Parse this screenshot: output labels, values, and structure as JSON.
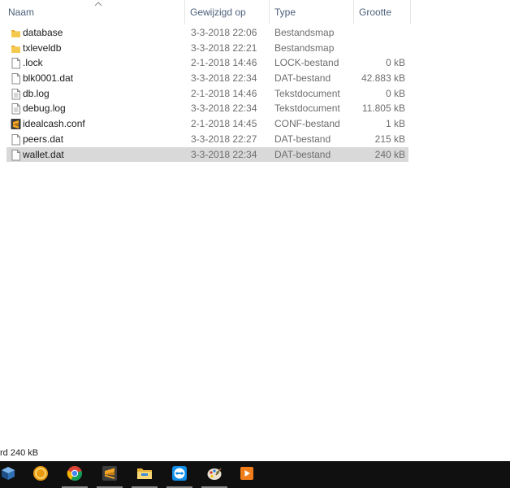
{
  "columns": {
    "name": "Naam",
    "modified": "Gewijzigd op",
    "type": "Type",
    "size": "Grootte"
  },
  "files": [
    {
      "name": "database",
      "modified": "3-3-2018 22:06",
      "type": "Bestandsmap",
      "size": "",
      "icon": "folder-icon"
    },
    {
      "name": "txleveldb",
      "modified": "3-3-2018 22:21",
      "type": "Bestandsmap",
      "size": "",
      "icon": "folder-icon"
    },
    {
      "name": ".lock",
      "modified": "2-1-2018 14:46",
      "type": "LOCK-bestand",
      "size": "0 kB",
      "icon": "file-icon"
    },
    {
      "name": "blk0001.dat",
      "modified": "3-3-2018 22:34",
      "type": "DAT-bestand",
      "size": "42.883 kB",
      "icon": "file-icon"
    },
    {
      "name": "db.log",
      "modified": "2-1-2018 14:46",
      "type": "Tekstdocument",
      "size": "0 kB",
      "icon": "text-file-icon"
    },
    {
      "name": "debug.log",
      "modified": "3-3-2018 22:34",
      "type": "Tekstdocument",
      "size": "11.805 kB",
      "icon": "text-file-icon"
    },
    {
      "name": "idealcash.conf",
      "modified": "2-1-2018 14:45",
      "type": "CONF-bestand",
      "size": "1 kB",
      "icon": "sublime-file-icon"
    },
    {
      "name": "peers.dat",
      "modified": "3-3-2018 22:27",
      "type": "DAT-bestand",
      "size": "215 kB",
      "icon": "file-icon"
    },
    {
      "name": "wallet.dat",
      "modified": "3-3-2018 22:34",
      "type": "DAT-bestand",
      "size": "240 kB",
      "icon": "file-icon"
    }
  ],
  "selected_index": 8,
  "status": {
    "text": "rd  240 kB"
  },
  "taskbar": {
    "items": [
      "virtualbox-icon",
      "coin-app-icon",
      "chrome-icon",
      "sublime-text-icon",
      "file-explorer-icon",
      "teamviewer-icon",
      "paint-icon",
      "media-player-icon"
    ]
  },
  "colors": {
    "selection": "#d9d9d9",
    "header_text": "#4c607a",
    "folder": "#e8b33a",
    "taskbar": "#101010"
  }
}
